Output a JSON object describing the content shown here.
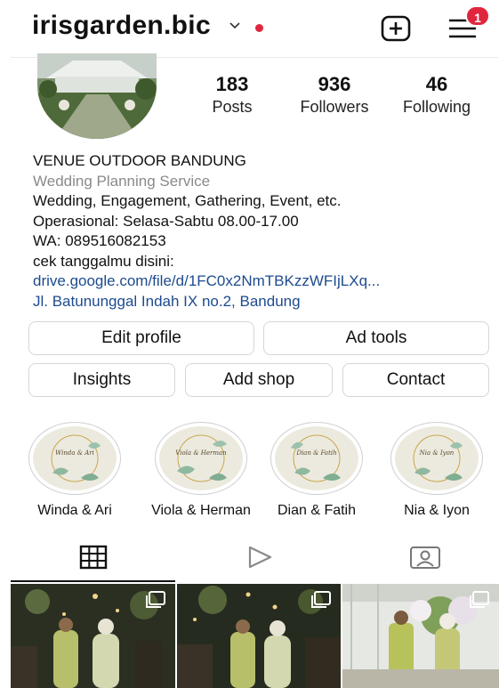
{
  "header": {
    "username": "irisgarden.bic",
    "notifications_count": "1",
    "icons": {
      "dropdown": "chevron-down-icon",
      "create": "plus-square-icon",
      "menu": "hamburger-menu-icon"
    },
    "live_dot_color": "#e0263f"
  },
  "stats": [
    {
      "number": "183",
      "label": "Posts"
    },
    {
      "number": "936",
      "label": "Followers"
    },
    {
      "number": "46",
      "label": "Following"
    }
  ],
  "bio": {
    "name": "VENUE OUTDOOR BANDUNG",
    "category": "Wedding Planning Service",
    "lines": [
      "Wedding, Engagement, Gathering, Event, etc.",
      "Operasional: Selasa-Sabtu 08.00-17.00",
      "WA: 089516082153",
      "cek tanggalmu disini:"
    ],
    "link": "drive.google.com/file/d/1FC0x2NmTBKzzWFIjLXq...",
    "address": "Jl. Batununggal Indah IX no.2, Bandung",
    "link_color": "#1d4b8f"
  },
  "buttons": {
    "edit_profile": "Edit profile",
    "ad_tools": "Ad tools",
    "insights": "Insights",
    "add_shop": "Add shop",
    "contact": "Contact"
  },
  "highlights": [
    {
      "caption": "Winda & Ari",
      "cover_text": "Winda & Ari"
    },
    {
      "caption": "Viola & Herman",
      "cover_text": "Viola & Herman"
    },
    {
      "caption": "Dian & Fatih",
      "cover_text": "Dian & Fatih"
    },
    {
      "caption": "Nia & Iyon",
      "cover_text": "Nia & Iyon"
    }
  ],
  "tabs": {
    "active": "grid",
    "icons": [
      "grid-icon",
      "reels-play-icon",
      "tagged-person-icon"
    ]
  },
  "posts": [
    {
      "type": "carousel"
    },
    {
      "type": "carousel"
    },
    {
      "type": "carousel"
    }
  ]
}
